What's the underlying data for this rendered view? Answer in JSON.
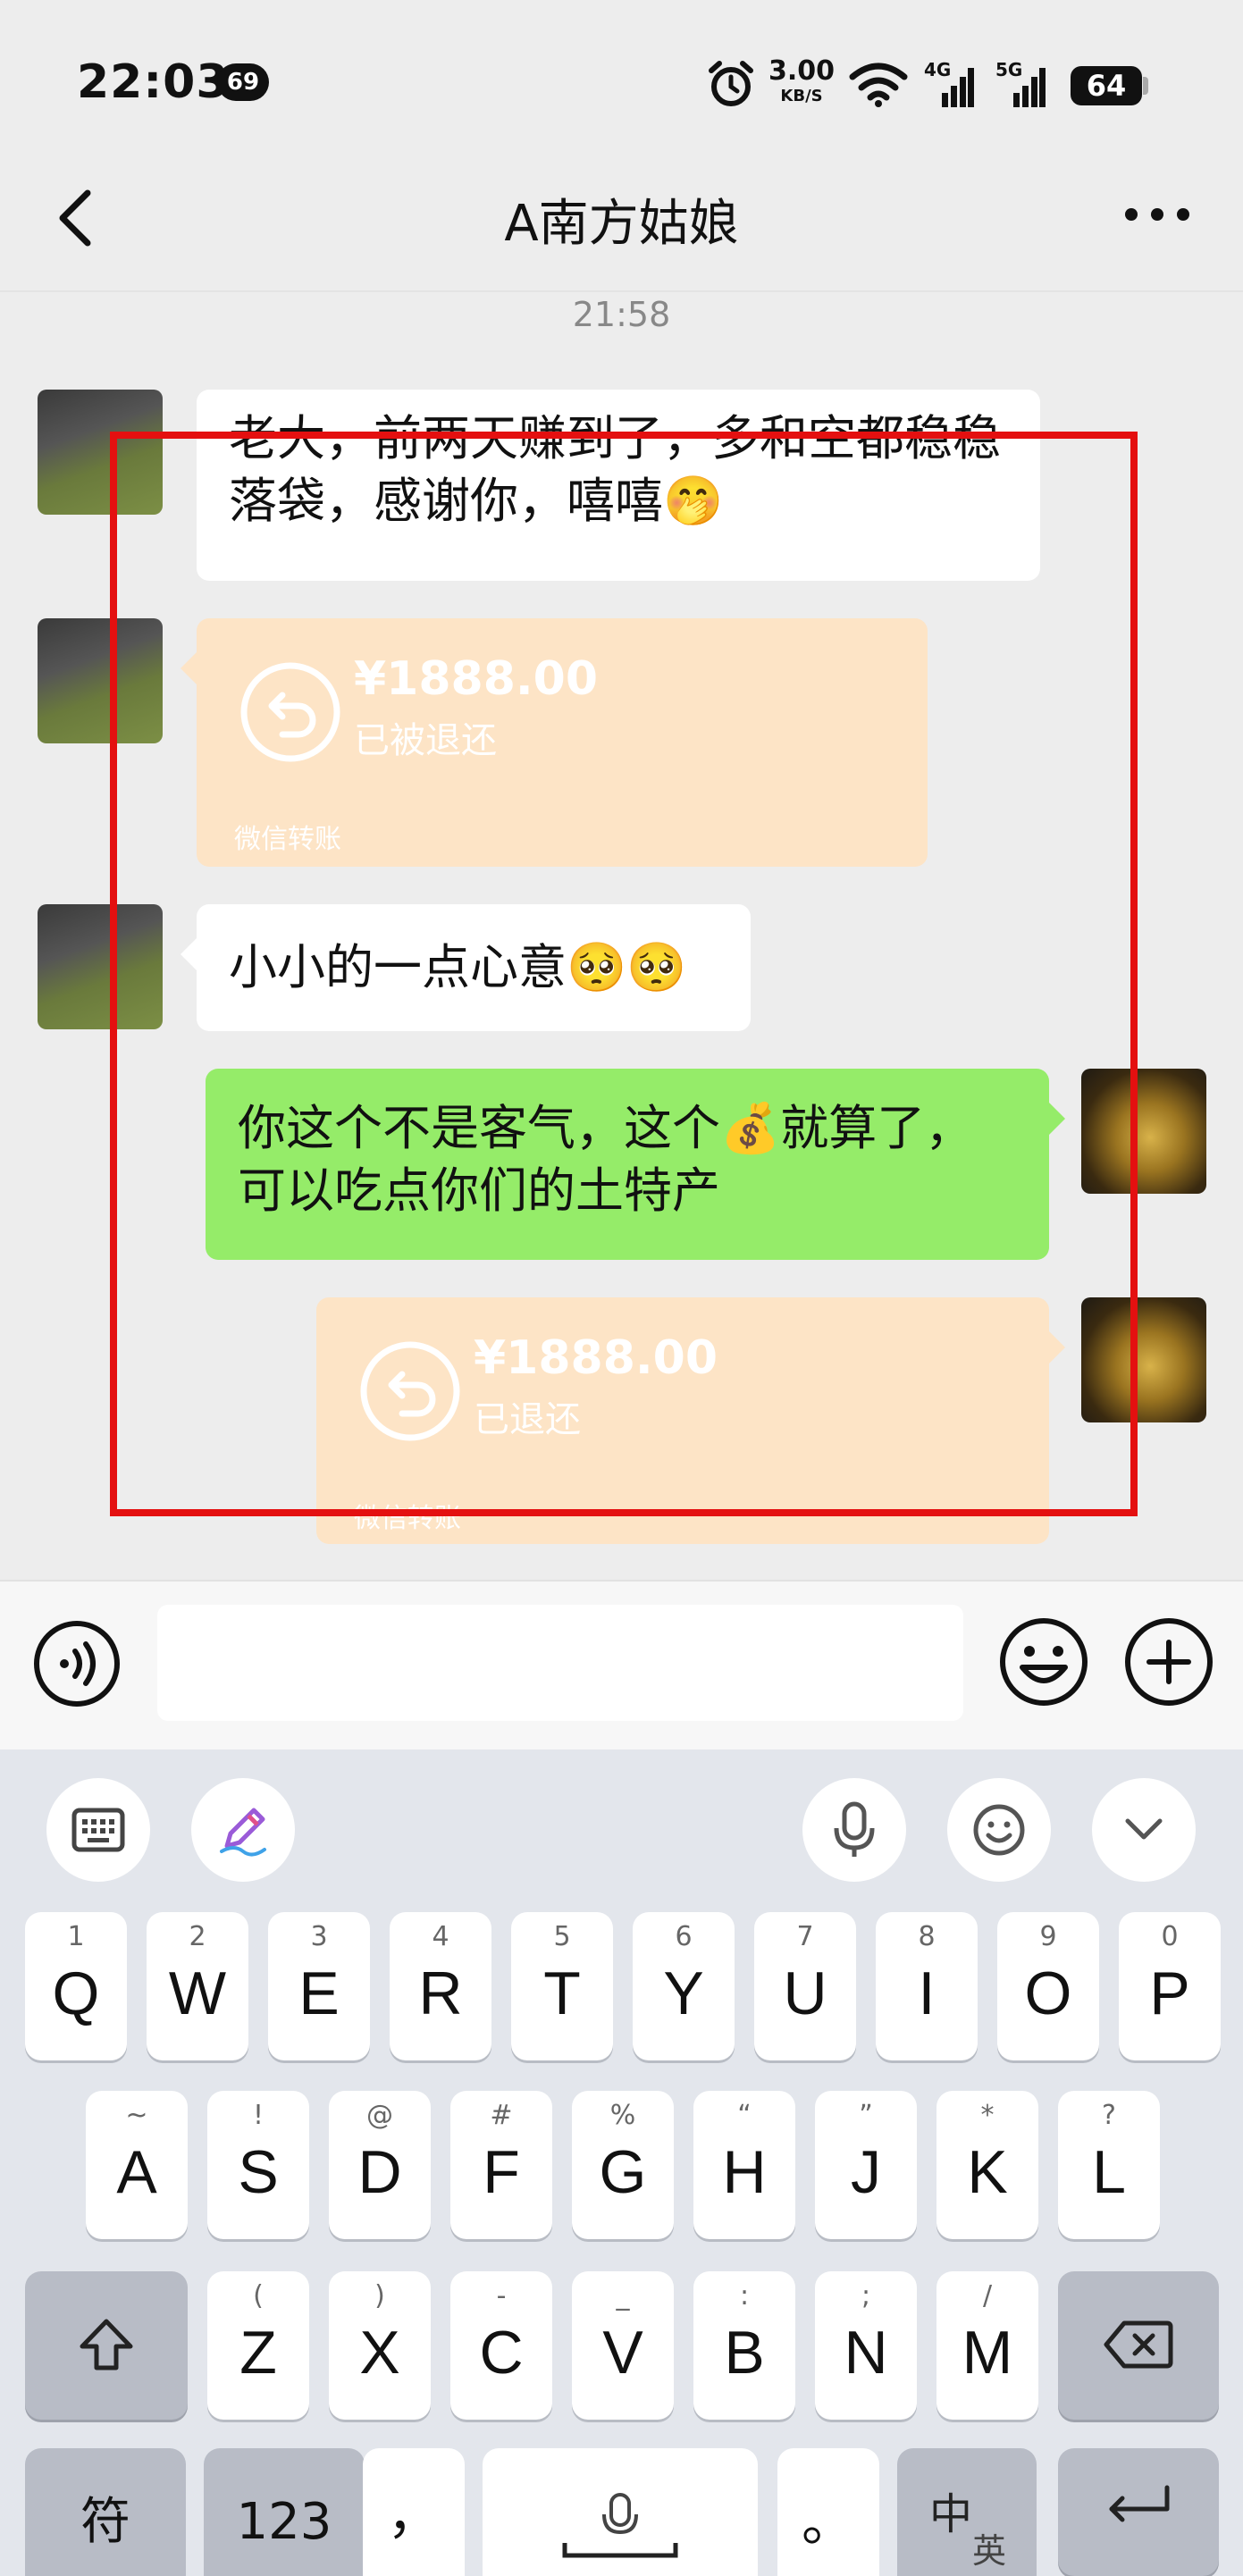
{
  "status_bar": {
    "time": "22:03",
    "badge": "69",
    "speed_value": "3.00",
    "speed_unit": "KB/S",
    "signal_4g": "4G",
    "signal_5g": "5G",
    "battery": "64"
  },
  "nav": {
    "title": "A南方姑娘"
  },
  "chat": {
    "timestamp": "21:58",
    "msg1_text": "老大，前两天赚到了，多和空都稳稳落袋，感谢你，嘻嘻🤭",
    "transfer1": {
      "amount": "¥1888.00",
      "status": "已被退还",
      "footer": "微信转账"
    },
    "msg2_text": "小小的一点心意🥺🥺",
    "msg3_text": "你这个不是客气，这个💰就算了，可以吃点你们的土特产",
    "transfer2": {
      "amount": "¥1888.00",
      "status": "已退还",
      "footer": "微信转账"
    }
  },
  "colors": {
    "chat_bg": "#ededed",
    "green_bubble": "#95ec69",
    "transfer_bubble": "#fde4c6",
    "highlight_border": "#e41010"
  },
  "keyboard": {
    "row1": [
      {
        "hint": "1",
        "key": "Q"
      },
      {
        "hint": "2",
        "key": "W"
      },
      {
        "hint": "3",
        "key": "E"
      },
      {
        "hint": "4",
        "key": "R"
      },
      {
        "hint": "5",
        "key": "T"
      },
      {
        "hint": "6",
        "key": "Y"
      },
      {
        "hint": "7",
        "key": "U"
      },
      {
        "hint": "8",
        "key": "I"
      },
      {
        "hint": "9",
        "key": "O"
      },
      {
        "hint": "0",
        "key": "P"
      }
    ],
    "row2": [
      {
        "hint": "~",
        "key": "A"
      },
      {
        "hint": "!",
        "key": "S"
      },
      {
        "hint": "@",
        "key": "D"
      },
      {
        "hint": "#",
        "key": "F"
      },
      {
        "hint": "%",
        "key": "G"
      },
      {
        "hint": "“",
        "key": "H"
      },
      {
        "hint": "”",
        "key": "J"
      },
      {
        "hint": "*",
        "key": "K"
      },
      {
        "hint": "?",
        "key": "L"
      }
    ],
    "row3": [
      {
        "hint": "(",
        "key": "Z"
      },
      {
        "hint": ")",
        "key": "X"
      },
      {
        "hint": "-",
        "key": "C"
      },
      {
        "hint": "_",
        "key": "V"
      },
      {
        "hint": ":",
        "key": "B"
      },
      {
        "hint": ";",
        "key": "N"
      },
      {
        "hint": "/",
        "key": "M"
      }
    ],
    "symbol_key": "符",
    "number_key": "123",
    "comma_key": "，",
    "period_key": "。",
    "lang_top": "中",
    "lang_bottom": "英"
  }
}
